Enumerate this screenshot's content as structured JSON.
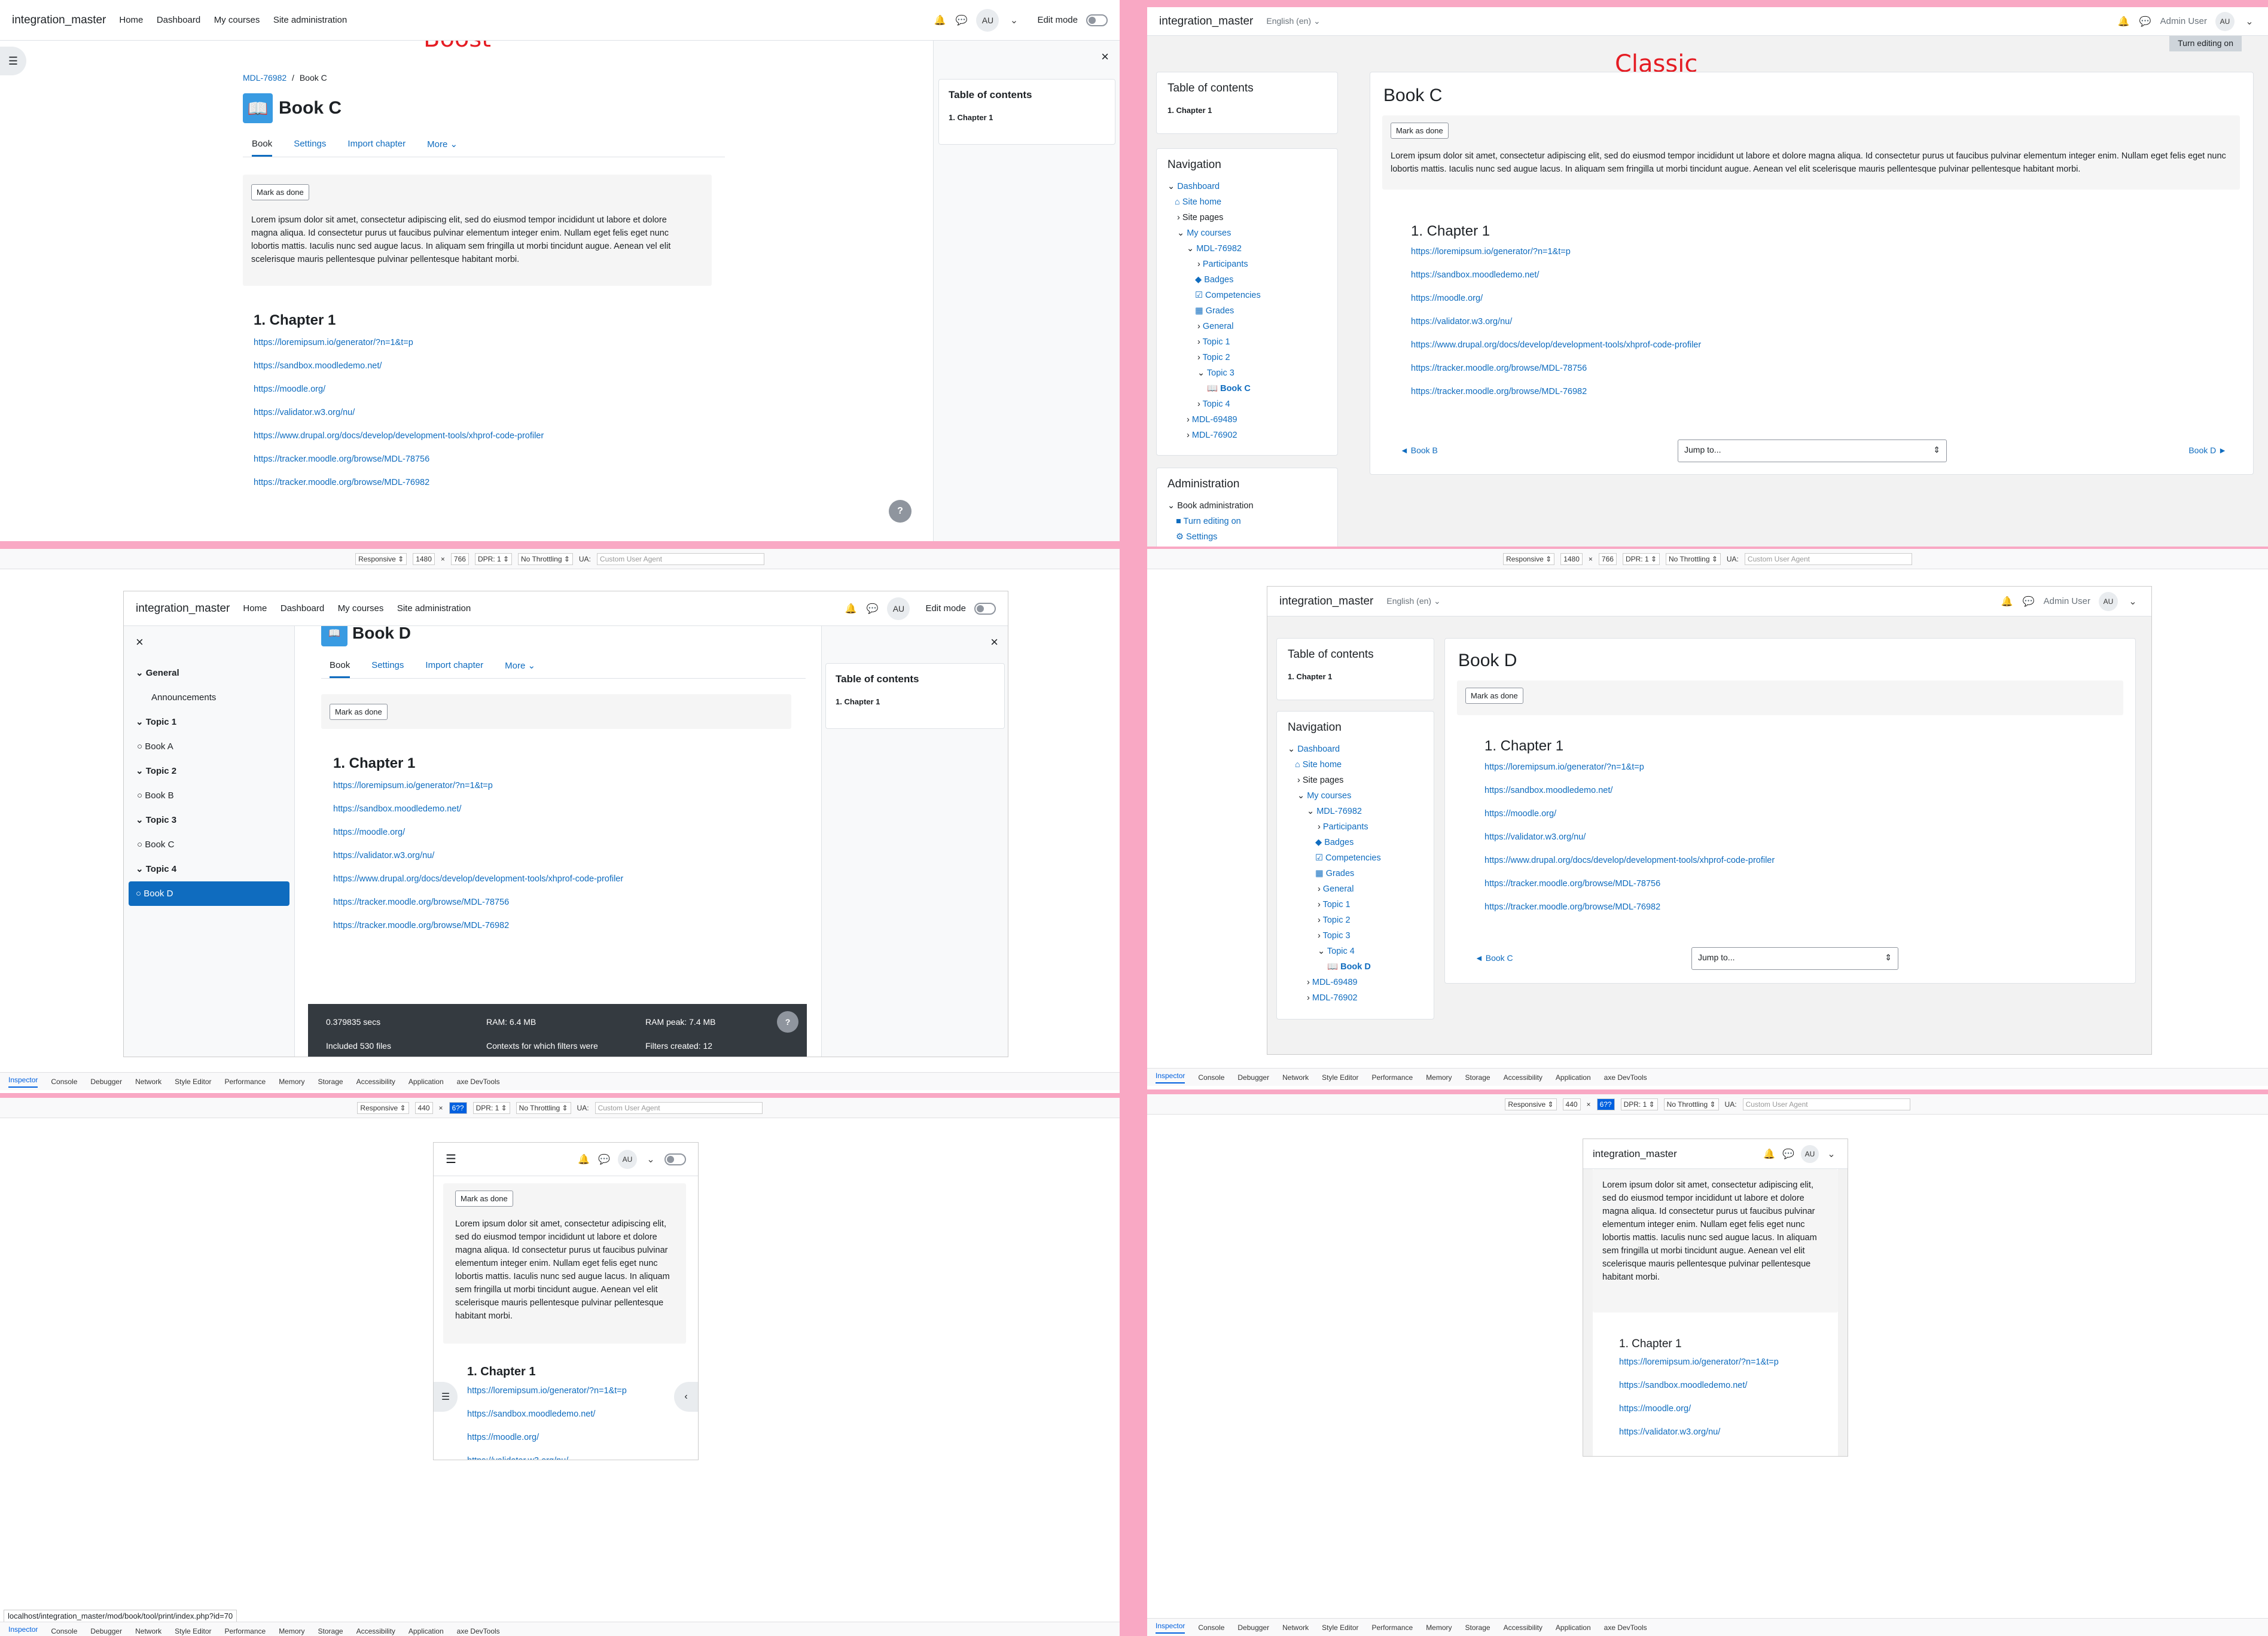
{
  "labels": {
    "boost": "Boost",
    "classic": "Classic"
  },
  "site_name": "integration_master",
  "nav": {
    "home": "Home",
    "dashboard": "Dashboard",
    "my_courses": "My courses",
    "site_admin": "Site administration",
    "edit_mode": "Edit mode",
    "avatar": "AU",
    "language": "English (en)",
    "admin_user": "Admin User",
    "turn_editing_on": "Turn editing on"
  },
  "breadcrumb": {
    "course": "MDL-76982",
    "sep": "/",
    "book": "Book C"
  },
  "tabs": {
    "book": "Book",
    "settings": "Settings",
    "import": "Import chapter",
    "more": "More"
  },
  "book_c": {
    "title": "Book C",
    "mark_done": "Mark as done",
    "description": "Lorem ipsum dolor sit amet, consectetur adipiscing elit, sed do eiusmod tempor incididunt ut labore et dolore magna aliqua. Id consectetur purus ut faucibus pulvinar elementum integer enim. Nullam eget felis eget nunc lobortis mattis. Iaculis nunc sed augue lacus. In aliquam sem fringilla ut morbi tincidunt augue. Aenean vel elit scelerisque mauris pellentesque pulvinar pellentesque habitant morbi.",
    "chapter": "1. Chapter 1"
  },
  "book_d": {
    "title": "Book D",
    "partial_title": "Book D"
  },
  "links": [
    "https://loremipsum.io/generator/?n=1&t=p",
    "https://sandbox.moodledemo.net/",
    "https://moodle.org/",
    "https://validator.w3.org/nu/",
    "https://www.drupal.org/docs/develop/development-tools/xhprof-code-profiler",
    "https://tracker.moodle.org/browse/MDL-78756",
    "https://tracker.moodle.org/browse/MDL-76982"
  ],
  "toc": {
    "title": "Table of contents",
    "item": "1. Chapter 1"
  },
  "classic_nav": {
    "title": "Navigation",
    "dashboard": "Dashboard",
    "site_home": "Site home",
    "site_pages": "Site pages",
    "my_courses": "My courses",
    "course": "MDL-76982",
    "participants": "Participants",
    "badges": "Badges",
    "competencies": "Competencies",
    "grades": "Grades",
    "general": "General",
    "topic1": "Topic 1",
    "topic2": "Topic 2",
    "topic3": "Topic 3",
    "book_c": "Book C",
    "topic4": "Topic 4",
    "book_d": "Book D",
    "course2": "MDL-69489",
    "course3": "MDL-76902"
  },
  "admin": {
    "title": "Administration",
    "book_admin": "Book administration",
    "turn_editing": "Turn editing on",
    "settings": "Settings"
  },
  "pager": {
    "prev_c": "◄ Book B",
    "next_c": "Book D ►",
    "prev_d": "◄ Book C",
    "jump": "Jump to..."
  },
  "course_index": {
    "general": "General",
    "announcements": "Announcements",
    "topic1": "Topic 1",
    "book_a": "Book A",
    "topic2": "Topic 2",
    "book_b": "Book B",
    "topic3": "Topic 3",
    "book_c": "Book C",
    "topic4": "Topic 4",
    "book_d": "Book D"
  },
  "perf": {
    "secs": "0.379835 secs",
    "ram": "RAM: 6.4 MB",
    "ram_peak": "RAM peak: 7.4 MB",
    "files": "Included 530 files",
    "contexts": "Contexts for which filters were",
    "filters": "Filters created: 12"
  },
  "devtools": {
    "responsive": "Responsive ⇕",
    "w1480": "1480",
    "x": "×",
    "h766": "766",
    "dpr": "DPR: 1 ⇕",
    "throttle": "No Throttling ⇕",
    "ua": "UA:",
    "ua_ph": "Custom User Agent",
    "w440": "440",
    "h_sel": "6??",
    "tabs": [
      "Inspector",
      "Console",
      "Debugger",
      "Network",
      "Style Editor",
      "Performance",
      "Memory",
      "Storage",
      "Accessibility",
      "Application",
      "axe DevTools"
    ]
  },
  "status_url": "localhost/integration_master/mod/book/tool/print/index.php?id=70",
  "mobile_desc": "Lorem ipsum dolor sit amet, consectetur adipiscing elit, sed do eiusmod tempor incididunt ut labore et dolore magna aliqua. Id consectetur purus ut faucibus pulvinar elementum integer enim. Nullam eget felis eget nunc lobortis mattis. Iaculis nunc sed augue lacus. In aliquam sem fringilla ut morbi tincidunt augue. Aenean vel elit scelerisque mauris pellentesque pulvinar pellentesque habitant morbi.",
  "help": "?"
}
